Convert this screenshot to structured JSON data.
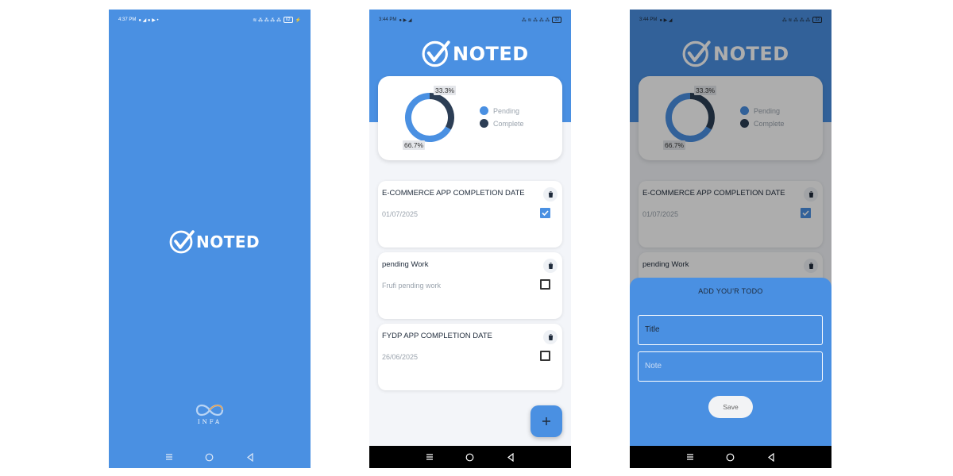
{
  "colors": {
    "primary": "#4a90e2",
    "dark": "#2c3e55",
    "background": "#f3f5f9"
  },
  "splash": {
    "status_time": "4:37 PM",
    "battery": "62",
    "logo_text": "NOTED",
    "brand": "INFA"
  },
  "main": {
    "status_time": "3:44 PM",
    "battery": "32",
    "logo_text": "NOTED",
    "chart_data": {
      "type": "pie",
      "categories": [
        "Pending",
        "Complete"
      ],
      "values": [
        66.7,
        33.3
      ],
      "labels": [
        "66.7%",
        "33.3%"
      ],
      "colors": [
        "#4a90e2",
        "#2c3e55"
      ],
      "legend": "right"
    },
    "todos": [
      {
        "title": "E-COMMERCE APP COMPLETION DATE",
        "note": "01/07/2025",
        "checked": true
      },
      {
        "title": "pending Work",
        "note": "Frufi pending work",
        "checked": false
      },
      {
        "title": "FYDP APP COMPLETION DATE",
        "note": "26/06/2025",
        "checked": false
      }
    ],
    "fab_icon": "plus-icon"
  },
  "add_todo": {
    "status_time": "3:44 PM",
    "sheet_title": "ADD YOU'R TODO",
    "title_placeholder": "Title",
    "note_placeholder": "Note",
    "save_label": "Save"
  }
}
